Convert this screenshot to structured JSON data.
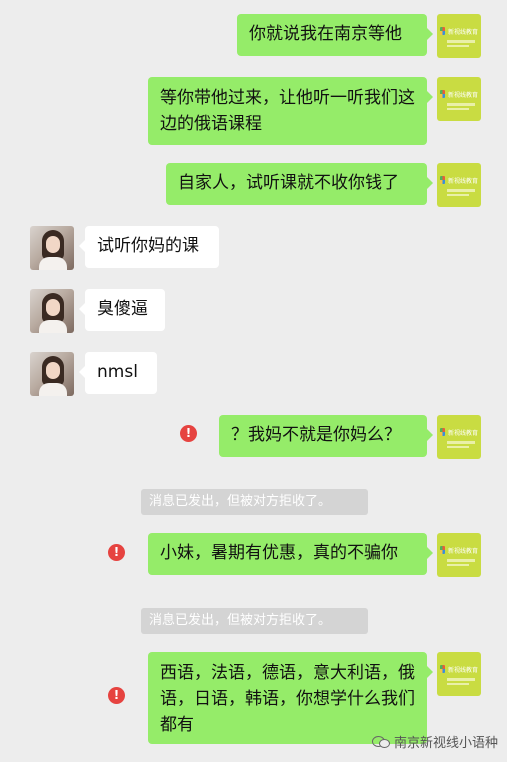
{
  "sender_avatar": {
    "logo_text": "新视线教育"
  },
  "messages": [
    {
      "side": "me",
      "text": "你就说我在南京等他"
    },
    {
      "side": "me",
      "text": "等你带他过来，让他听一听我们这边的俄语课程"
    },
    {
      "side": "me",
      "text": "自家人，试听课就不收你钱了"
    },
    {
      "side": "them",
      "text": "试听你妈的课"
    },
    {
      "side": "them",
      "text": "臭傻逼"
    },
    {
      "side": "them",
      "text": "nmsl"
    },
    {
      "side": "me",
      "text": "？我妈不就是你妈么？",
      "failed": true
    },
    {
      "side": "system",
      "text": "消息已发出，但被对方拒收了。"
    },
    {
      "side": "me",
      "text": "小妹，暑期有优惠，真的不骗你",
      "failed": true
    },
    {
      "side": "system",
      "text": "消息已发出，但被对方拒收了。"
    },
    {
      "side": "me",
      "text": "西语，法语，德语，意大利语，俄语，日语，韩语，你想学什么我们都有",
      "failed": true
    }
  ],
  "warn_glyph": "!",
  "watermark": "南京新视线小语种",
  "colors": {
    "my_bubble": "#95ec69",
    "their_bubble": "#ffffff",
    "background": "#ededed",
    "error": "#e64340"
  }
}
